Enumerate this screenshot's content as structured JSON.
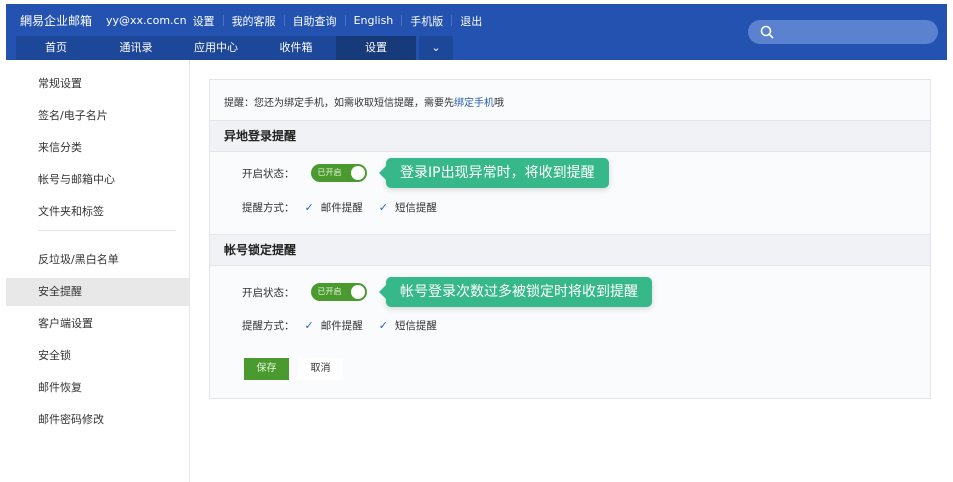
{
  "header": {
    "logo": "網易企业邮箱",
    "account": "yy@xx.com.cn",
    "links": [
      "设置",
      "我的客服",
      "自助查询",
      "English",
      "手机版",
      "退出"
    ],
    "tabs": [
      "首页",
      "通讯录",
      "应用中心",
      "收件箱",
      "设置"
    ],
    "active_tab": "设置",
    "search_placeholder": ""
  },
  "sidebar": {
    "items": [
      "常规设置",
      "签名/电子名片",
      "来信分类",
      "帐号与邮箱中心",
      "文件夹和标签",
      "反垃圾/黑白名单",
      "安全提醒",
      "客户端设置",
      "安全锁",
      "邮件恢复",
      "邮件密码修改"
    ],
    "active": "安全提醒"
  },
  "main": {
    "notice_prefix": "提醒：您还为绑定手机，如需收取短信提醒，需要先",
    "notice_link": "绑定手机",
    "notice_suffix": "哦",
    "sections": [
      {
        "title": "异地登录提醒",
        "status_label": "开启状态：",
        "toggle_text": "已开启",
        "toggle_on": true,
        "tooltip": "登录IP出现异常时，将收到提醒",
        "method_label": "提醒方式：",
        "methods": [
          "邮件提醒",
          "短信提醒"
        ]
      },
      {
        "title": "帐号锁定提醒",
        "status_label": "开启状态：",
        "toggle_text": "已开启",
        "toggle_on": true,
        "tooltip": "帐号登录次数过多被锁定时将收到提醒",
        "method_label": "提醒方式：",
        "methods": [
          "邮件提醒",
          "短信提醒"
        ]
      }
    ],
    "save": "保存",
    "cancel": "取消"
  },
  "colors": {
    "header": "#2352b0",
    "accent_green": "#4a9a2f",
    "tooltip": "#37b88a"
  }
}
